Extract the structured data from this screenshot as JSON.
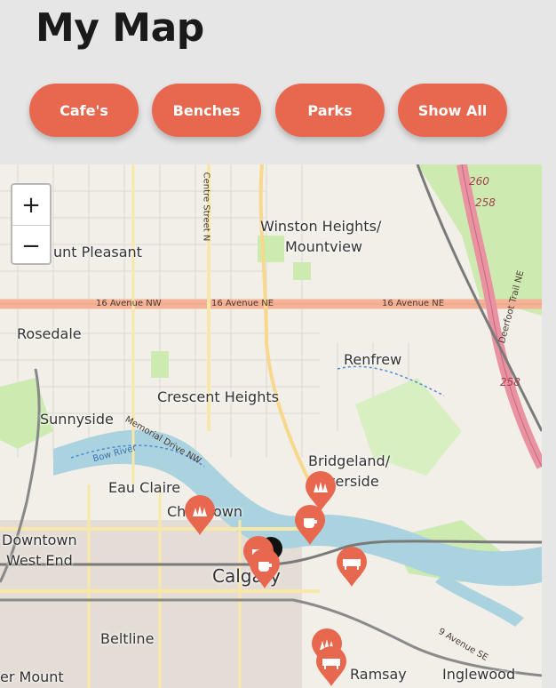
{
  "page": {
    "title": "My Map"
  },
  "filters": [
    {
      "label": "Cafe's"
    },
    {
      "label": "Benches"
    },
    {
      "label": "Parks"
    },
    {
      "label": "Show All"
    }
  ],
  "zoom": {
    "in_label": "+",
    "out_label": "−"
  },
  "map_labels": {
    "mount_pleasant": "unt Pleasant",
    "winston_1": "Winston Heights/",
    "winston_2": "Mountview",
    "rosedale": "Rosedale",
    "renfrew": "Renfrew",
    "crescent_heights": "Crescent Heights",
    "sunnyside": "Sunnyside",
    "bridgeland_1": "Bridgeland/",
    "bridgeland_2": "verside",
    "eau_claire": "Eau Claire",
    "chinatown": "Chinatown",
    "downtown_1": "Downtown",
    "downtown_2": "West End",
    "calgary": "Calgary",
    "beltline": "Beltline",
    "ramsay": "Ramsay",
    "inglewood": "Inglewood",
    "mount": "er Mount"
  },
  "road_labels": {
    "sixteen_nw": "16 Avenue NW",
    "sixteen_ne_1": "16 Avenue NE",
    "sixteen_ne_2": "16 Avenue NE",
    "centre_street": "Centre Street N",
    "deerfoot": "Deerfoot Trail NE",
    "memorial": "Memorial Drive NW",
    "bow_river": "Bow River",
    "ninth_ave": "9 Avenue SE",
    "hwy_260": "260",
    "hwy_258a": "258",
    "hwy_258b": "258"
  },
  "markers": [
    {
      "kind": "park",
      "icon": "park-icon"
    },
    {
      "kind": "park",
      "icon": "park-icon"
    },
    {
      "kind": "cafe",
      "icon": "cafe-icon"
    },
    {
      "kind": "cafe",
      "icon": "cafe-icon"
    },
    {
      "kind": "cafe",
      "icon": "cafe-icon"
    },
    {
      "kind": "bench",
      "icon": "bench-icon"
    },
    {
      "kind": "park",
      "icon": "park-icon"
    },
    {
      "kind": "bench",
      "icon": "bench-icon"
    }
  ],
  "colors": {
    "accent": "#e8674f",
    "background": "#e6e6e6",
    "map_land": "#f2efe9",
    "map_green": "#cdebb0",
    "map_water": "#aad3df",
    "major_road": "#f4b297",
    "highway": "#e892a2",
    "rail": "#7a7a7a"
  }
}
